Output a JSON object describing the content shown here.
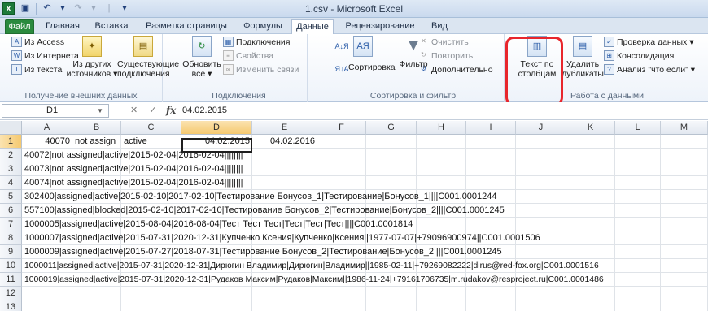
{
  "app": {
    "logo": "X",
    "title": "1.csv - Microsoft Excel"
  },
  "quick_access": {
    "icons": [
      "save-icon",
      "undo-icon",
      "redo-icon"
    ],
    "glyphs": [
      "▣",
      "↶",
      "↷",
      "▾",
      "|",
      "▾"
    ]
  },
  "tabs": [
    {
      "label": "Файл"
    },
    {
      "label": "Главная"
    },
    {
      "label": "Вставка"
    },
    {
      "label": "Разметка страницы"
    },
    {
      "label": "Формулы"
    },
    {
      "label": "Данные"
    },
    {
      "label": "Рецензирование"
    },
    {
      "label": "Вид"
    }
  ],
  "active_tab": "Данные",
  "ribbon": {
    "get_external": {
      "from_access": "Из Access",
      "from_web": "Из Интернета",
      "from_text": "Из текста",
      "from_other_1": "Из других",
      "from_other_2": "источников ▾",
      "existing_1": "Существующие",
      "existing_2": "подключения",
      "label": "Получение внешних данных"
    },
    "connections": {
      "refresh_1": "Обновить",
      "refresh_2": "все ▾",
      "connections": "Подключения",
      "properties": "Свойства",
      "edit_links": "Изменить связи",
      "label": "Подключения"
    },
    "sort_filter": {
      "sort_az": "А↓Я",
      "sort_za": "Я↓А",
      "sort": "Сортировка",
      "filter": "Фильтр",
      "clear": "Очистить",
      "reapply": "Повторить",
      "advanced": "Дополнительно",
      "label": "Сортировка и фильтр"
    },
    "data_tools": {
      "text_to_columns_1": "Текст по",
      "text_to_columns_2": "столбцам",
      "remove_dup_1": "Удалить",
      "remove_dup_2": "дубликаты",
      "validation": "Проверка данных ▾",
      "consolidate": "Консолидация",
      "whatif": "Анализ \"что если\" ▾",
      "label": "Работа с данными"
    }
  },
  "formula_bar": {
    "name_box": "D1",
    "fx": "fx",
    "value": "04.02.2015"
  },
  "columns": [
    "A",
    "B",
    "C",
    "D",
    "E",
    "F",
    "G",
    "H",
    "I",
    "J",
    "K",
    "L",
    "M",
    "N"
  ],
  "selected_column": "D",
  "rows": [
    "1",
    "2",
    "3",
    "4",
    "5",
    "6",
    "7",
    "8",
    "9",
    "10",
    "11",
    "12",
    "13"
  ],
  "row1": {
    "a": "40070",
    "b": "not assign",
    "c": "active",
    "d": "04.02.2015",
    "e": "04.02.2016"
  },
  "lines": [
    "40072|not assigned|active|2015-02-04|2016-02-04||||||||",
    "40073|not assigned|active|2015-02-04|2016-02-04||||||||",
    "40074|not assigned|active|2015-02-04|2016-02-04||||||||",
    "302400|assigned|active|2015-02-10|2017-02-10|Тестирование Бонусов_1|Тестирование|Бонусов_1||||C001.0001244",
    "557100|assigned|blocked|2015-02-10|2017-02-10|Тестирование Бонусов_2|Тестирование|Бонусов_2||||C001.0001245",
    "1000005|assigned|active|2015-08-04|2016-08-04|Тест Тест Тест|Тест|Тест|Тест||||C001.0001814",
    "1000007|assigned|active|2015-07-31|2020-12-31|Купченко Ксения|Купченко|Ксения||1977-07-07|+79096900974||C001.0001506",
    "1000009|assigned|active|2015-07-27|2018-07-31|Тестирование Бонусов_2|Тестирование|Бонусов_2||||C001.0001245",
    "1000011|assigned|active|2015-07-31|2020-12-31|Дирюгин Владимир|Дирюгин|Владимир||1985-02-11|+79269082222|dirus@red-fox.org|C001.0001516",
    "1000019|assigned|active|2015-07-31|2020-12-31|Рудаков Максим|Рудаков|Максим||1986-11-24|+79161706735|m.rudakov@resproject.ru|C001.0001486"
  ],
  "colors": {
    "file_tab": "#2a8a3e",
    "selection_header": "#f5c970",
    "highlight": "#e8262c"
  }
}
